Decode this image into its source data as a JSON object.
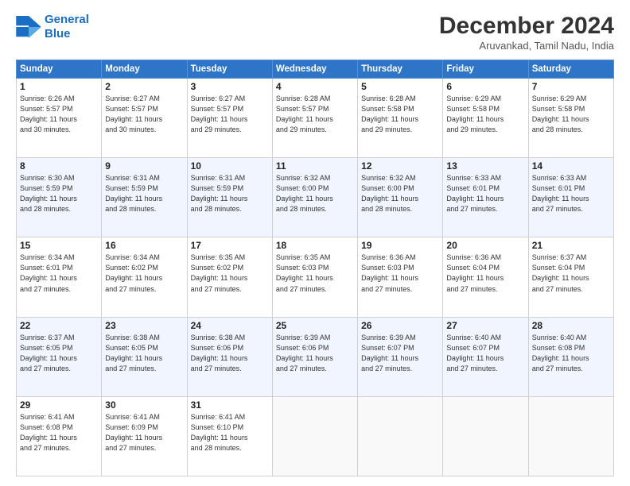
{
  "header": {
    "logo_line1": "General",
    "logo_line2": "Blue",
    "month": "December 2024",
    "location": "Aruvankad, Tamil Nadu, India"
  },
  "days_of_week": [
    "Sunday",
    "Monday",
    "Tuesday",
    "Wednesday",
    "Thursday",
    "Friday",
    "Saturday"
  ],
  "weeks": [
    [
      {
        "day": 1,
        "info": "Sunrise: 6:26 AM\nSunset: 5:57 PM\nDaylight: 11 hours\nand 30 minutes."
      },
      {
        "day": 2,
        "info": "Sunrise: 6:27 AM\nSunset: 5:57 PM\nDaylight: 11 hours\nand 30 minutes."
      },
      {
        "day": 3,
        "info": "Sunrise: 6:27 AM\nSunset: 5:57 PM\nDaylight: 11 hours\nand 29 minutes."
      },
      {
        "day": 4,
        "info": "Sunrise: 6:28 AM\nSunset: 5:57 PM\nDaylight: 11 hours\nand 29 minutes."
      },
      {
        "day": 5,
        "info": "Sunrise: 6:28 AM\nSunset: 5:58 PM\nDaylight: 11 hours\nand 29 minutes."
      },
      {
        "day": 6,
        "info": "Sunrise: 6:29 AM\nSunset: 5:58 PM\nDaylight: 11 hours\nand 29 minutes."
      },
      {
        "day": 7,
        "info": "Sunrise: 6:29 AM\nSunset: 5:58 PM\nDaylight: 11 hours\nand 28 minutes."
      }
    ],
    [
      {
        "day": 8,
        "info": "Sunrise: 6:30 AM\nSunset: 5:59 PM\nDaylight: 11 hours\nand 28 minutes."
      },
      {
        "day": 9,
        "info": "Sunrise: 6:31 AM\nSunset: 5:59 PM\nDaylight: 11 hours\nand 28 minutes."
      },
      {
        "day": 10,
        "info": "Sunrise: 6:31 AM\nSunset: 5:59 PM\nDaylight: 11 hours\nand 28 minutes."
      },
      {
        "day": 11,
        "info": "Sunrise: 6:32 AM\nSunset: 6:00 PM\nDaylight: 11 hours\nand 28 minutes."
      },
      {
        "day": 12,
        "info": "Sunrise: 6:32 AM\nSunset: 6:00 PM\nDaylight: 11 hours\nand 28 minutes."
      },
      {
        "day": 13,
        "info": "Sunrise: 6:33 AM\nSunset: 6:01 PM\nDaylight: 11 hours\nand 27 minutes."
      },
      {
        "day": 14,
        "info": "Sunrise: 6:33 AM\nSunset: 6:01 PM\nDaylight: 11 hours\nand 27 minutes."
      }
    ],
    [
      {
        "day": 15,
        "info": "Sunrise: 6:34 AM\nSunset: 6:01 PM\nDaylight: 11 hours\nand 27 minutes."
      },
      {
        "day": 16,
        "info": "Sunrise: 6:34 AM\nSunset: 6:02 PM\nDaylight: 11 hours\nand 27 minutes."
      },
      {
        "day": 17,
        "info": "Sunrise: 6:35 AM\nSunset: 6:02 PM\nDaylight: 11 hours\nand 27 minutes."
      },
      {
        "day": 18,
        "info": "Sunrise: 6:35 AM\nSunset: 6:03 PM\nDaylight: 11 hours\nand 27 minutes."
      },
      {
        "day": 19,
        "info": "Sunrise: 6:36 AM\nSunset: 6:03 PM\nDaylight: 11 hours\nand 27 minutes."
      },
      {
        "day": 20,
        "info": "Sunrise: 6:36 AM\nSunset: 6:04 PM\nDaylight: 11 hours\nand 27 minutes."
      },
      {
        "day": 21,
        "info": "Sunrise: 6:37 AM\nSunset: 6:04 PM\nDaylight: 11 hours\nand 27 minutes."
      }
    ],
    [
      {
        "day": 22,
        "info": "Sunrise: 6:37 AM\nSunset: 6:05 PM\nDaylight: 11 hours\nand 27 minutes."
      },
      {
        "day": 23,
        "info": "Sunrise: 6:38 AM\nSunset: 6:05 PM\nDaylight: 11 hours\nand 27 minutes."
      },
      {
        "day": 24,
        "info": "Sunrise: 6:38 AM\nSunset: 6:06 PM\nDaylight: 11 hours\nand 27 minutes."
      },
      {
        "day": 25,
        "info": "Sunrise: 6:39 AM\nSunset: 6:06 PM\nDaylight: 11 hours\nand 27 minutes."
      },
      {
        "day": 26,
        "info": "Sunrise: 6:39 AM\nSunset: 6:07 PM\nDaylight: 11 hours\nand 27 minutes."
      },
      {
        "day": 27,
        "info": "Sunrise: 6:40 AM\nSunset: 6:07 PM\nDaylight: 11 hours\nand 27 minutes."
      },
      {
        "day": 28,
        "info": "Sunrise: 6:40 AM\nSunset: 6:08 PM\nDaylight: 11 hours\nand 27 minutes."
      }
    ],
    [
      {
        "day": 29,
        "info": "Sunrise: 6:41 AM\nSunset: 6:08 PM\nDaylight: 11 hours\nand 27 minutes."
      },
      {
        "day": 30,
        "info": "Sunrise: 6:41 AM\nSunset: 6:09 PM\nDaylight: 11 hours\nand 27 minutes."
      },
      {
        "day": 31,
        "info": "Sunrise: 6:41 AM\nSunset: 6:10 PM\nDaylight: 11 hours\nand 28 minutes."
      },
      {
        "day": null
      },
      {
        "day": null
      },
      {
        "day": null
      },
      {
        "day": null
      }
    ]
  ]
}
